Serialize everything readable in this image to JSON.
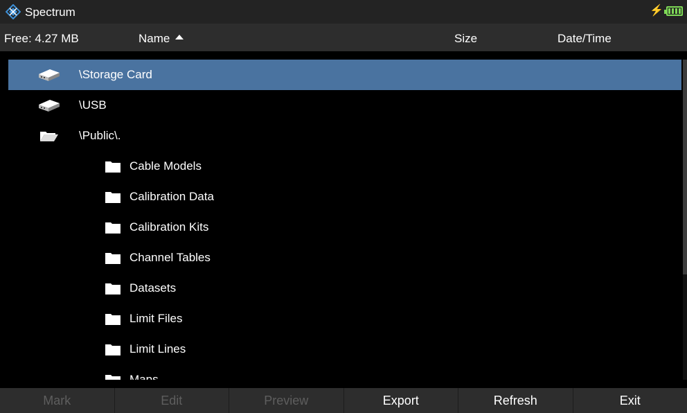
{
  "window": {
    "title": "Spectrum"
  },
  "header": {
    "free_space": "Free: 4.27 MB",
    "col_name": "Name",
    "col_size": "Size",
    "col_datetime": "Date/Time",
    "sort_order": "ascending"
  },
  "list": {
    "items": [
      {
        "label": "\\Storage Card",
        "icon": "storage-drive-icon",
        "selected": true
      },
      {
        "label": "\\USB",
        "icon": "usb-drive-icon",
        "selected": false
      },
      {
        "label": "\\Public\\.",
        "icon": "open-folder-icon",
        "selected": false
      },
      {
        "label": "Cable Models",
        "icon": "folder-icon",
        "selected": false
      },
      {
        "label": "Calibration Data",
        "icon": "folder-icon",
        "selected": false
      },
      {
        "label": "Calibration Kits",
        "icon": "folder-icon",
        "selected": false
      },
      {
        "label": "Channel Tables",
        "icon": "folder-icon",
        "selected": false
      },
      {
        "label": "Datasets",
        "icon": "folder-icon",
        "selected": false
      },
      {
        "label": "Limit Files",
        "icon": "folder-icon",
        "selected": false
      },
      {
        "label": "Limit Lines",
        "icon": "folder-icon",
        "selected": false
      },
      {
        "label": "Maps",
        "icon": "folder-icon",
        "selected": false
      }
    ]
  },
  "softkeys": [
    {
      "label": "Mark",
      "enabled": false
    },
    {
      "label": "Edit",
      "enabled": false
    },
    {
      "label": "Preview",
      "enabled": false
    },
    {
      "label": "Export",
      "enabled": true
    },
    {
      "label": "Refresh",
      "enabled": true
    },
    {
      "label": "Exit",
      "enabled": true
    }
  ],
  "colors": {
    "selection": "#4a73a0",
    "accent": "#3d8fd6",
    "battery": "#7ed957",
    "disabled_text": "#5e5e5e"
  }
}
